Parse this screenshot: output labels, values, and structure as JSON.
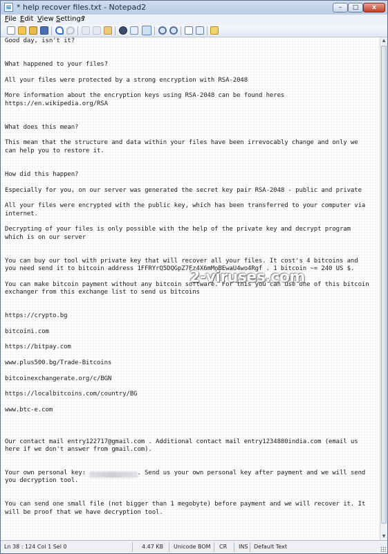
{
  "window": {
    "title": "* help recover files.txt - Notepad2",
    "min_glyph": "–",
    "max_glyph": "□",
    "close_glyph": "x"
  },
  "menu": {
    "items": [
      "File",
      "Edit",
      "View",
      "Settings",
      "?"
    ]
  },
  "toolbar": {
    "icons": [
      "new-file-icon",
      "open-folder-icon",
      "browse-icon",
      "save-icon",
      "undo-icon",
      "redo-icon",
      "cut-icon",
      "copy-icon",
      "paste-icon",
      "find-icon",
      "replace-icon",
      "word-wrap-icon",
      "zoom-in-icon",
      "zoom-out-icon",
      "scheme-icon",
      "customize-icon",
      "send-icon"
    ]
  },
  "document": {
    "text": "Good day, isn't it?\n\n\nWhat happened to your files?\n\nAll your files were protected by a strong encryption with RSA-2048\n\nMore information about the encryption keys using RSA-2048 can be found heres\nhttps://en.wikipedia.org/RSA\n\n\nWhat does this mean?\n\nThis mean that the structure and data within your files have been irrevocably change and only we\ncan help you to restore it.\n\n\nHow did this happen?\n\nEspecially for you, on our server was generated the secret key pair RSA-2048 - public and private\n\nAll your files were encrypted with the public key, which has been transferred to your computer via\ninternet.\n\nDecrypting of your files is only possible with the help of the private key and decrypt program\nwhich is on our server\n\n\nYou can buy our tool with private key that will recover all your files. It cost's 4 bitcoins and\nyou need send it to bitcoin address 1FFRYrQ5DQGpZ7Fz4X6mMoBEwaU4wo4Rgf . 1 bitcoin ~= 240 US $.\n\nYou can make bitcoin payment without any bitcoin software. For this you can use one of this bitcoin\nexchanger from this exchange list to send us bitcoins\n\n\nhttps://crypto.bg\n\nbitcoini.com\n\nhttps://bitpay.com\n\nwww.plus500.bg/Trade-Bitcoins\n\nbitcoinexchangerate.org/c/BGN\n\nhttps://localbitcoins.com/country/BG\n\nwww.btc-e.com\n\n\n\nOur contact mail entry122717@gmail.com . Additional contact mail entry1234880india.com (email us\nhere if we don't answer from gmail.com).\n\n\nYour own personal key:              . Send us your own personal key after payment and we will send\nyou decryption tool.\n\n\nYou can send one small file (not bigger than 1 megobyte) before payment and we will recover it. It\nwill be proof that we have decryption tool."
  },
  "watermark": {
    "text": "2-viruses.com"
  },
  "statusbar": {
    "position": "Ln 38 : 124   Col 1   Sel 0",
    "size": "4.47 KB",
    "encoding": "Unicode BOM",
    "line_ending": "CR",
    "insert_mode": "INS",
    "scheme": "Default Text"
  }
}
